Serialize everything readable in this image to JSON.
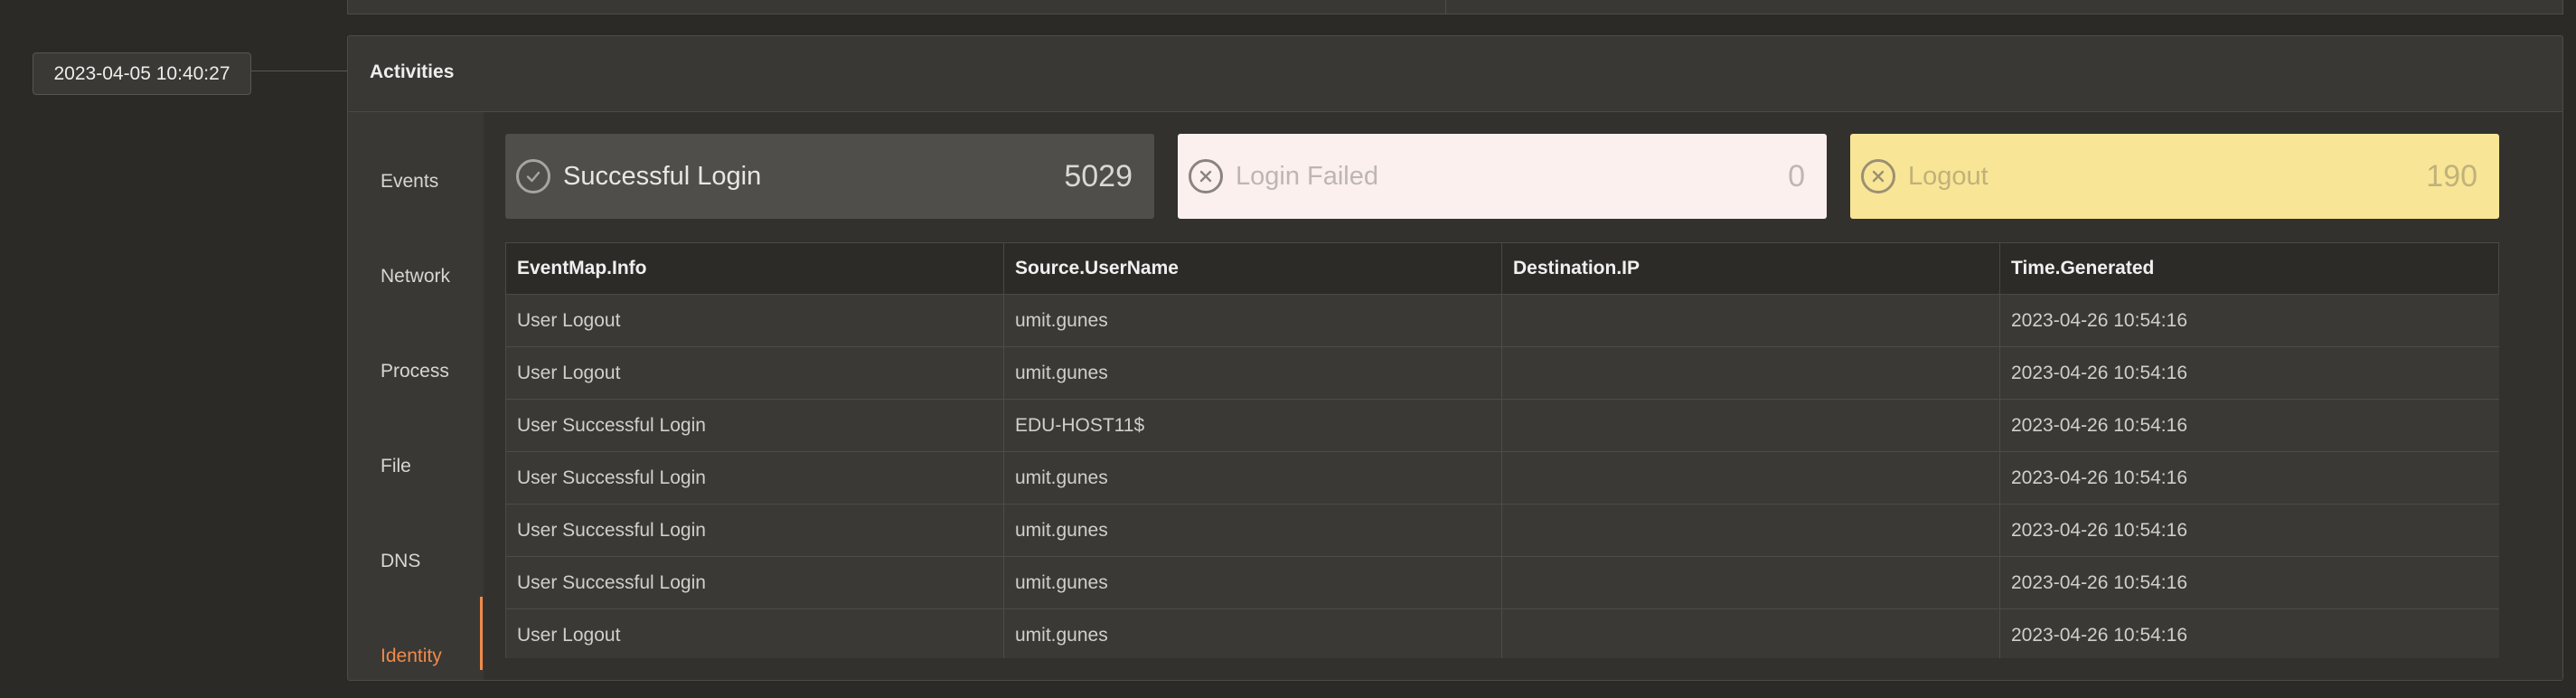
{
  "timestamp": "2023-04-05 10:40:27",
  "panel": {
    "title": "Activities"
  },
  "nav": {
    "items": [
      {
        "label": "Events",
        "active": false
      },
      {
        "label": "Network",
        "active": false
      },
      {
        "label": "Process",
        "active": false
      },
      {
        "label": "File",
        "active": false
      },
      {
        "label": "DNS",
        "active": false
      },
      {
        "label": "Identity",
        "active": true
      }
    ],
    "active_color": "#ef8b4a"
  },
  "stats": {
    "success": {
      "label": "Successful Login",
      "value": "5029",
      "icon": "check-circle-icon"
    },
    "failed": {
      "label": "Login Failed",
      "value": "0",
      "icon": "x-circle-icon"
    },
    "logout": {
      "label": "Logout",
      "value": "190",
      "icon": "x-circle-icon"
    }
  },
  "table": {
    "columns": [
      "EventMap.Info",
      "Source.UserName",
      "Destination.IP",
      "Time.Generated"
    ],
    "rows": [
      [
        "User Logout",
        "umit.gunes",
        "",
        "2023-04-26 10:54:16"
      ],
      [
        "User Logout",
        "umit.gunes",
        "",
        "2023-04-26 10:54:16"
      ],
      [
        "User Successful Login",
        "EDU-HOST11$",
        "",
        "2023-04-26 10:54:16"
      ],
      [
        "User Successful Login",
        "umit.gunes",
        "",
        "2023-04-26 10:54:16"
      ],
      [
        "User Successful Login",
        "umit.gunes",
        "",
        "2023-04-26 10:54:16"
      ],
      [
        "User Successful Login",
        "umit.gunes",
        "",
        "2023-04-26 10:54:16"
      ],
      [
        "User Logout",
        "umit.gunes",
        "",
        "2023-04-26 10:54:16"
      ]
    ]
  }
}
